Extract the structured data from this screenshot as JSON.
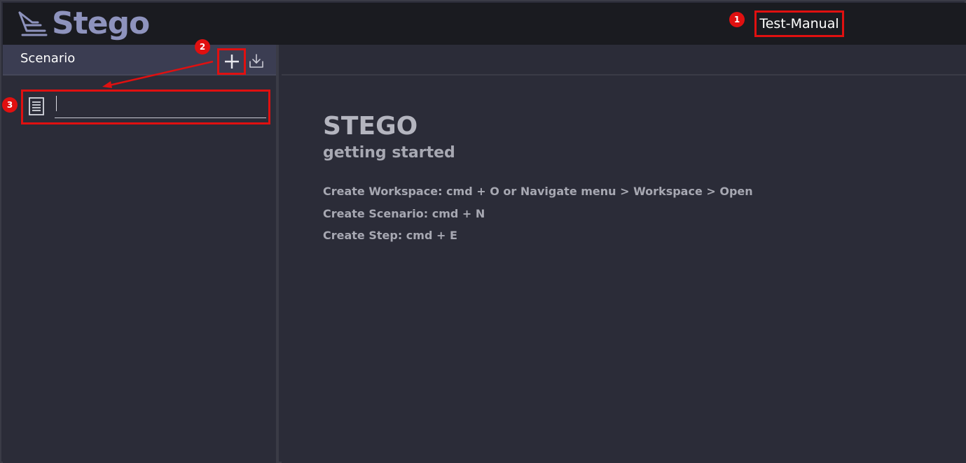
{
  "app": {
    "logo_text": "Stego",
    "logo_color": "#8e93bd",
    "workspace_name": "Test-Manual"
  },
  "sidebar": {
    "title": "Scenario",
    "add_icon": "plus-icon",
    "import_icon": "import-download-icon",
    "new_scenario": {
      "icon": "document-list-icon",
      "value": ""
    }
  },
  "main": {
    "title": "STEGO",
    "subtitle": "getting started",
    "shortcuts": [
      "Create Workspace: cmd + O or Navigate menu > Workspace > Open",
      "Create Scenario: cmd + N",
      "Create Step: cmd + E"
    ]
  },
  "annotations": {
    "markers": [
      "1",
      "2",
      "3"
    ],
    "color": "#e01010"
  }
}
